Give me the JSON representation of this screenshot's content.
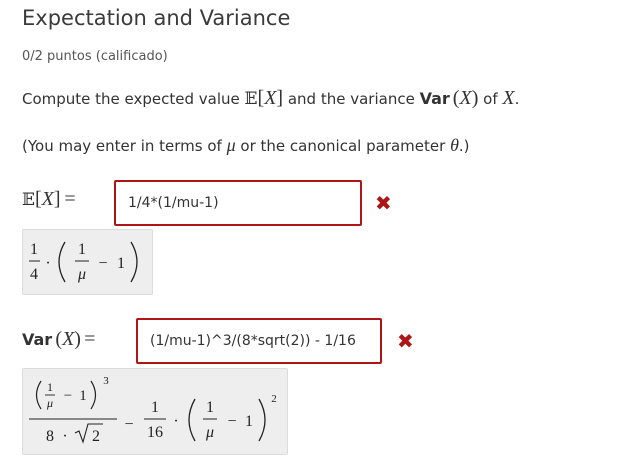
{
  "question": {
    "title": "Expectation and Variance",
    "score": "0/2 puntos (calificado)",
    "prompt": {
      "before": "Compute the expected value",
      "mid": "and the variance",
      "of": "of",
      "after": "."
    },
    "hint": {
      "before": "(You may enter in terms of",
      "mid": "or the canonical parameter",
      "after": ".)"
    }
  },
  "answers": [
    {
      "input_value": "1/4*(1/mu-1)",
      "status_icon": "cross-icon",
      "status_color": "#b01515"
    },
    {
      "input_value": "(1/mu-1)^3/(8*sqrt(2)) - 1/16",
      "status_icon": "cross-icon",
      "status_color": "#b01515"
    }
  ],
  "colors": {
    "error": "#b01515",
    "preview_bg": "#eeeeee"
  }
}
